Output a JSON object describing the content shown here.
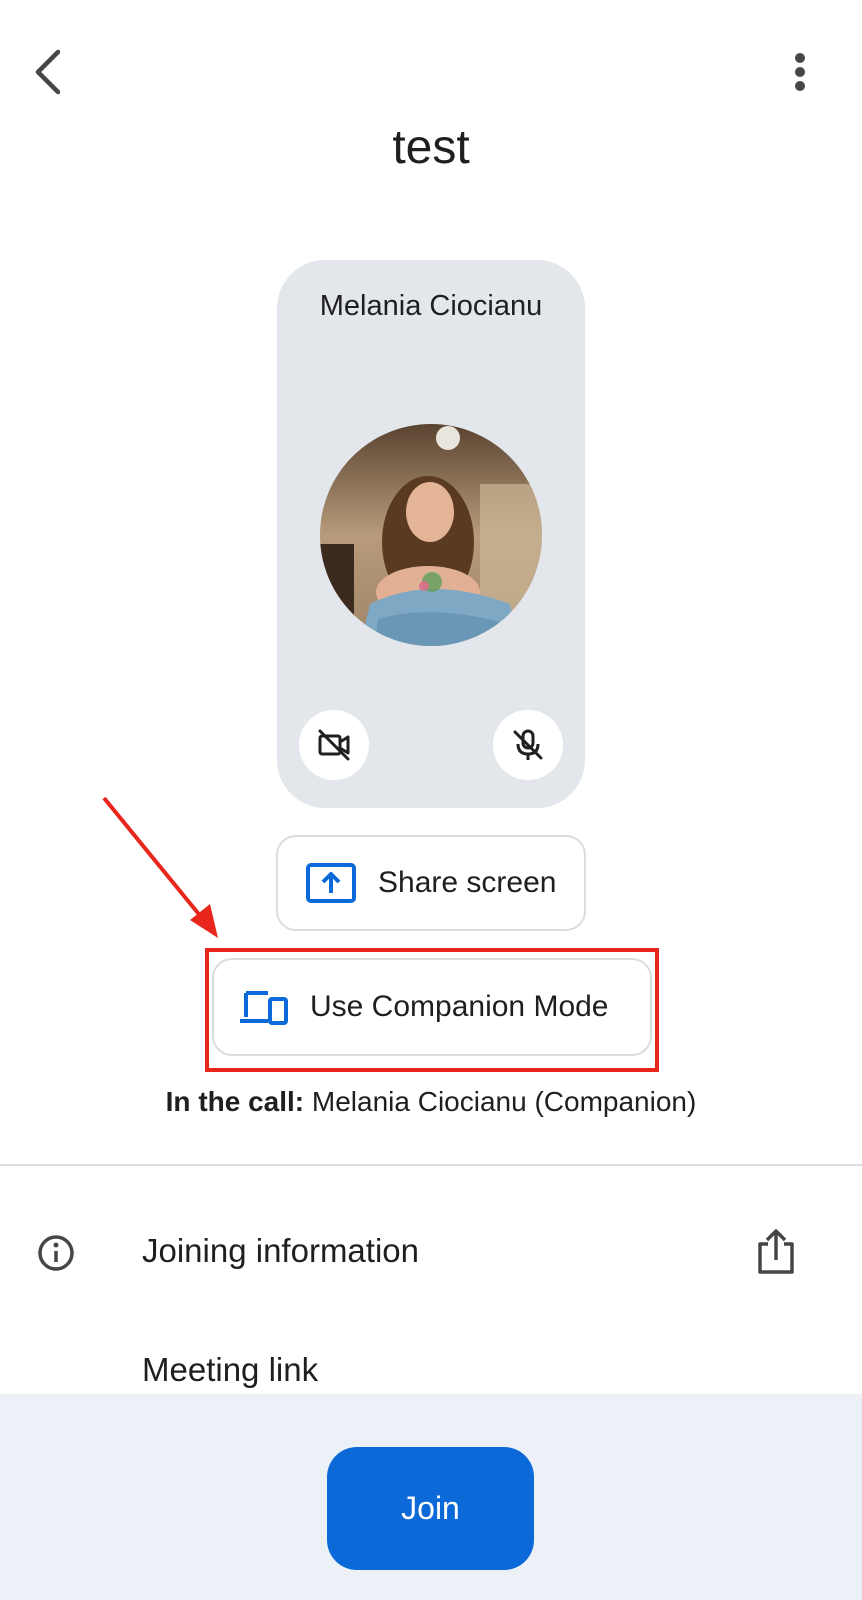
{
  "header": {
    "title": "test",
    "back_icon": "chevron-left-icon",
    "menu_icon": "more-vert-icon"
  },
  "preview": {
    "participant_name": "Melania Ciocianu",
    "camera_icon": "videocam-off-icon",
    "mic_icon": "mic-off-icon"
  },
  "actions": {
    "share_screen_label": "Share screen",
    "share_screen_icon": "present-to-all-icon",
    "companion_label": "Use Companion Mode",
    "companion_icon": "devices-icon"
  },
  "in_call": {
    "prefix": "In the call:",
    "names": "Melania Ciocianu (Companion)"
  },
  "joining_info": {
    "label": "Joining information",
    "info_icon": "info-icon",
    "share_icon": "share-icon",
    "meeting_link_label": "Meeting link"
  },
  "footer": {
    "join_label": "Join"
  },
  "colors": {
    "accent": "#0b69d8",
    "highlight": "#e8261c",
    "tile_bg": "#e3e7ec",
    "footer_bg": "#ecf1f8"
  }
}
